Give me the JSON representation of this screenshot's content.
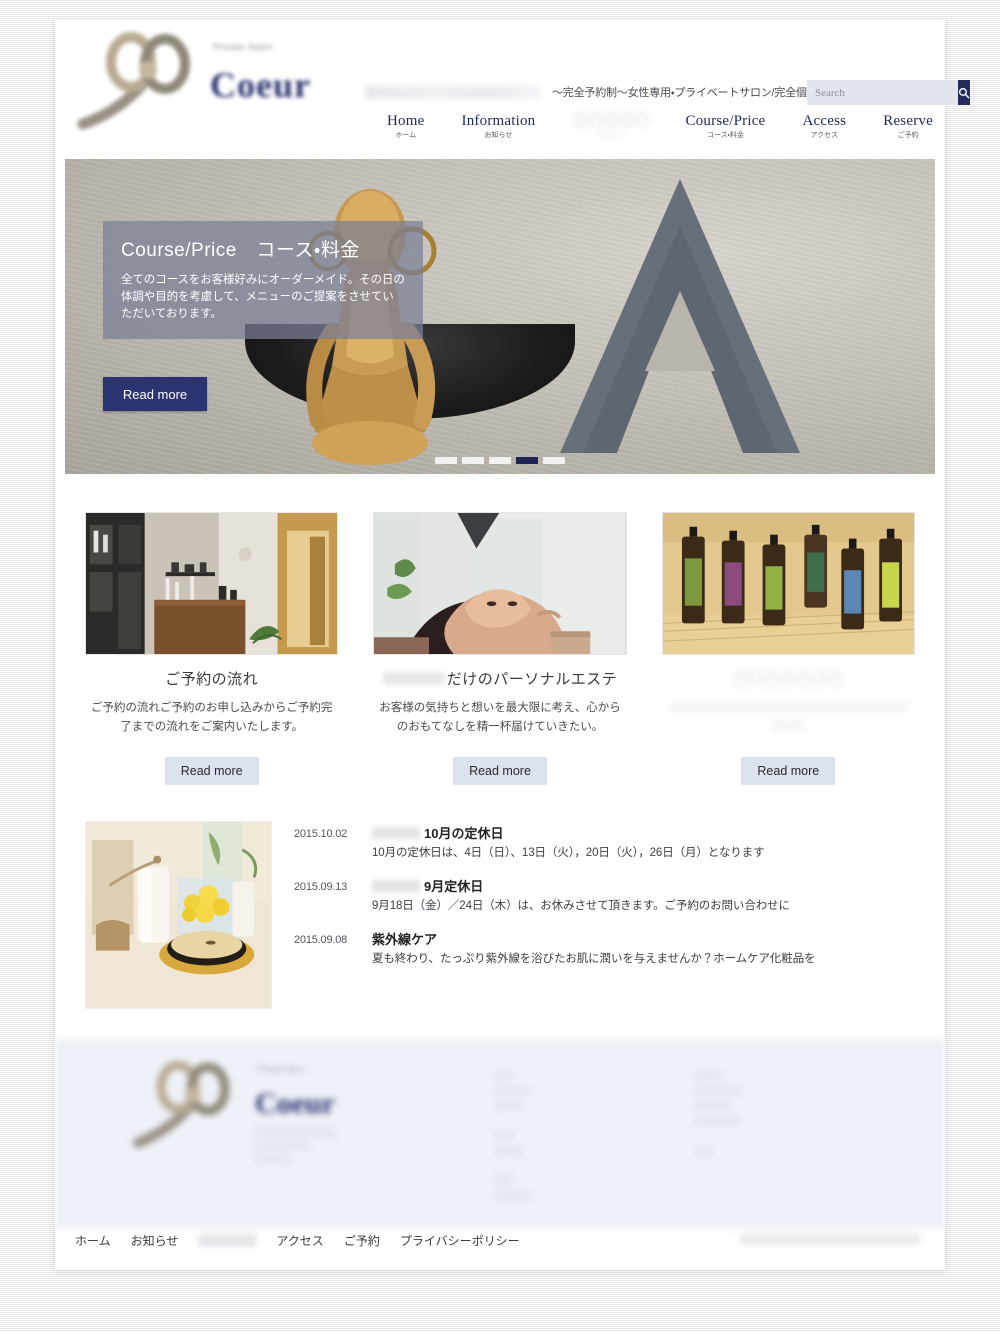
{
  "site": {
    "logo_name": "Coeur",
    "logo_sub": "Private Salon",
    "tagline": "～完全予約制～女性専用・プライベートサロン/完全個室"
  },
  "search": {
    "placeholder": "Search",
    "value": "",
    "icon": "search-icon"
  },
  "nav": [
    {
      "en": "Home",
      "jp": "ホーム",
      "redacted": false
    },
    {
      "en": "Information",
      "jp": "お知らせ",
      "redacted": false
    },
    {
      "en": "",
      "jp": "",
      "redacted": true
    },
    {
      "en": "Course/Price",
      "jp": "コース・料金",
      "redacted": false
    },
    {
      "en": "Access",
      "jp": "アクセス",
      "redacted": false
    },
    {
      "en": "Reserve",
      "jp": "ご予約",
      "redacted": false
    }
  ],
  "hero": {
    "title": "Course/Price　コース・料金",
    "description": "全てのコースをお客様好みにオーダーメイド。その日の体調や目的を考慮して、メニューのご提案をさせていただいております。",
    "button": "Read more",
    "slides_total": 5,
    "slide_active": 4
  },
  "cards": [
    {
      "title": "ご予約の流れ",
      "title_masked": false,
      "desc": "ご予約の流れご予約のお申し込みからご予約完了までの流れをご案内いたします。",
      "button": "Read more",
      "image": "salon-reception-photo",
      "redacted": false
    },
    {
      "title": "だけのパーソナルエステ",
      "title_masked": true,
      "desc": "お客様の気持ちと想いを最大限に考え、心からのおもてなしを精一杯届けていきたい。",
      "button": "Read more",
      "image": "facial-treatment-photo",
      "redacted": false
    },
    {
      "title": "",
      "title_masked": false,
      "desc": "",
      "button": "Read more",
      "image": "essential-oil-bottles-photo",
      "redacted": true
    }
  ],
  "news": {
    "thumbnail": "spa-cosmetics-photo",
    "items": [
      {
        "date": "2015.10.02",
        "title": "10月の定休日",
        "title_masked": true,
        "text": "10月の定休日は、4日（日）、13日（火），20日（火），26日（月）となります"
      },
      {
        "date": "2015.09.13",
        "title": "9月定休日",
        "title_masked": true,
        "text": "9月18日（金）／24日（木）は、お休みさせて頂きます。ご予約のお問い合わせに"
      },
      {
        "date": "2015.09.08",
        "title": "紫外線ケア",
        "title_masked": false,
        "text": "夏も終わり、たっぷり紫外線を浴びたお肌に潤いを与えませんか？ホームケア化粧品を"
      }
    ]
  },
  "footer": {
    "logo_name": "Coeur",
    "logo_sub": "Private Salon",
    "address_lines": "〇〇〇〇〇〇〇〇\n〇〇〇〇〇〇",
    "col2_lines": "〇〇\n〇〇〇〇\n〇〇〇\n〇〇\n〇〇〇〇",
    "col3_lines": "〇〇〇\n〇〇〇〇〇\n〇〇〇〇\n〇〇"
  },
  "bottom_nav": [
    {
      "label": "ホーム",
      "masked": false
    },
    {
      "label": "お知らせ",
      "masked": false
    },
    {
      "label": "",
      "masked": true
    },
    {
      "label": "アクセス",
      "masked": false
    },
    {
      "label": "ご予約",
      "masked": false
    },
    {
      "label": "プライバシーポリシー",
      "masked": false
    }
  ],
  "colors": {
    "brand_navy": "#2b3470",
    "button_light": "#dde3ee",
    "footer_bg": "#eef1f7",
    "search_bg": "#e4e6ee"
  }
}
